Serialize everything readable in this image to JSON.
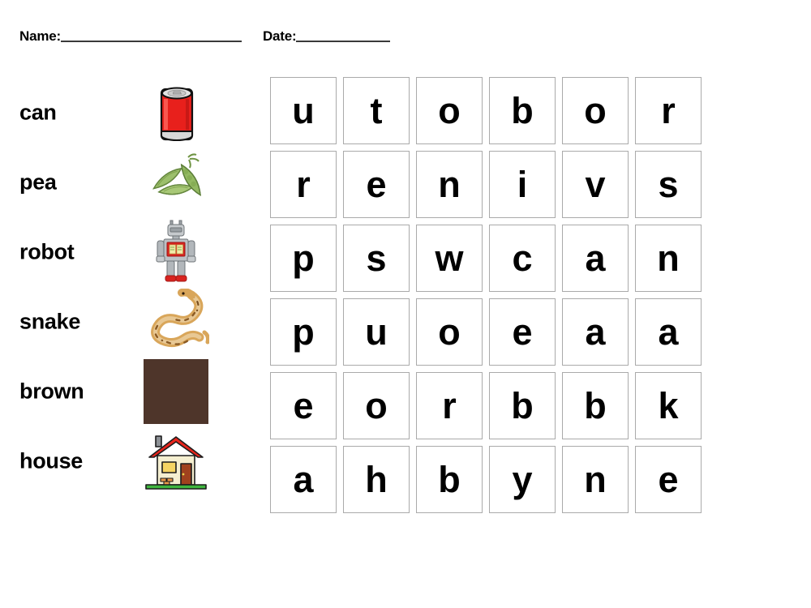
{
  "worksheet": {
    "header": {
      "name_label": "Name:",
      "date_label": "Date:"
    },
    "words": [
      {
        "text": "can",
        "icon": "soda-can-icon"
      },
      {
        "text": "pea",
        "icon": "pea-pods-icon"
      },
      {
        "text": "robot",
        "icon": "toy-robot-icon"
      },
      {
        "text": "snake",
        "icon": "snake-icon"
      },
      {
        "text": "brown",
        "icon": "brown-color-swatch-icon"
      },
      {
        "text": "house",
        "icon": "house-icon"
      }
    ],
    "grid": {
      "rows": 6,
      "columns": 6,
      "letters": [
        [
          "u",
          "t",
          "o",
          "b",
          "o",
          "r"
        ],
        [
          "r",
          "e",
          "n",
          "i",
          "v",
          "s"
        ],
        [
          "p",
          "s",
          "w",
          "c",
          "a",
          "n"
        ],
        [
          "p",
          "u",
          "o",
          "e",
          "a",
          "a"
        ],
        [
          "e",
          "o",
          "r",
          "b",
          "b",
          "k"
        ],
        [
          "a",
          "h",
          "b",
          "y",
          "n",
          "e"
        ]
      ]
    },
    "colors": {
      "cell_border": "#aaaaaa",
      "text": "#000000",
      "rule": "#3a3a3a",
      "brown_swatch": "#4a3228",
      "can_red": "#e8201c",
      "can_silver": "#d8d8d8",
      "pea_green": "#8fb364",
      "robot_silver": "#b8bcc0",
      "robot_red": "#d8231f",
      "snake_tan": "#d9a martin",
      "house_roof_red": "#e8251c",
      "house_wall_cream": "#f5efd0",
      "house_door_brown": "#a0411e",
      "house_window_yellow": "#f5d463",
      "grass_green": "#3eb53e"
    }
  }
}
